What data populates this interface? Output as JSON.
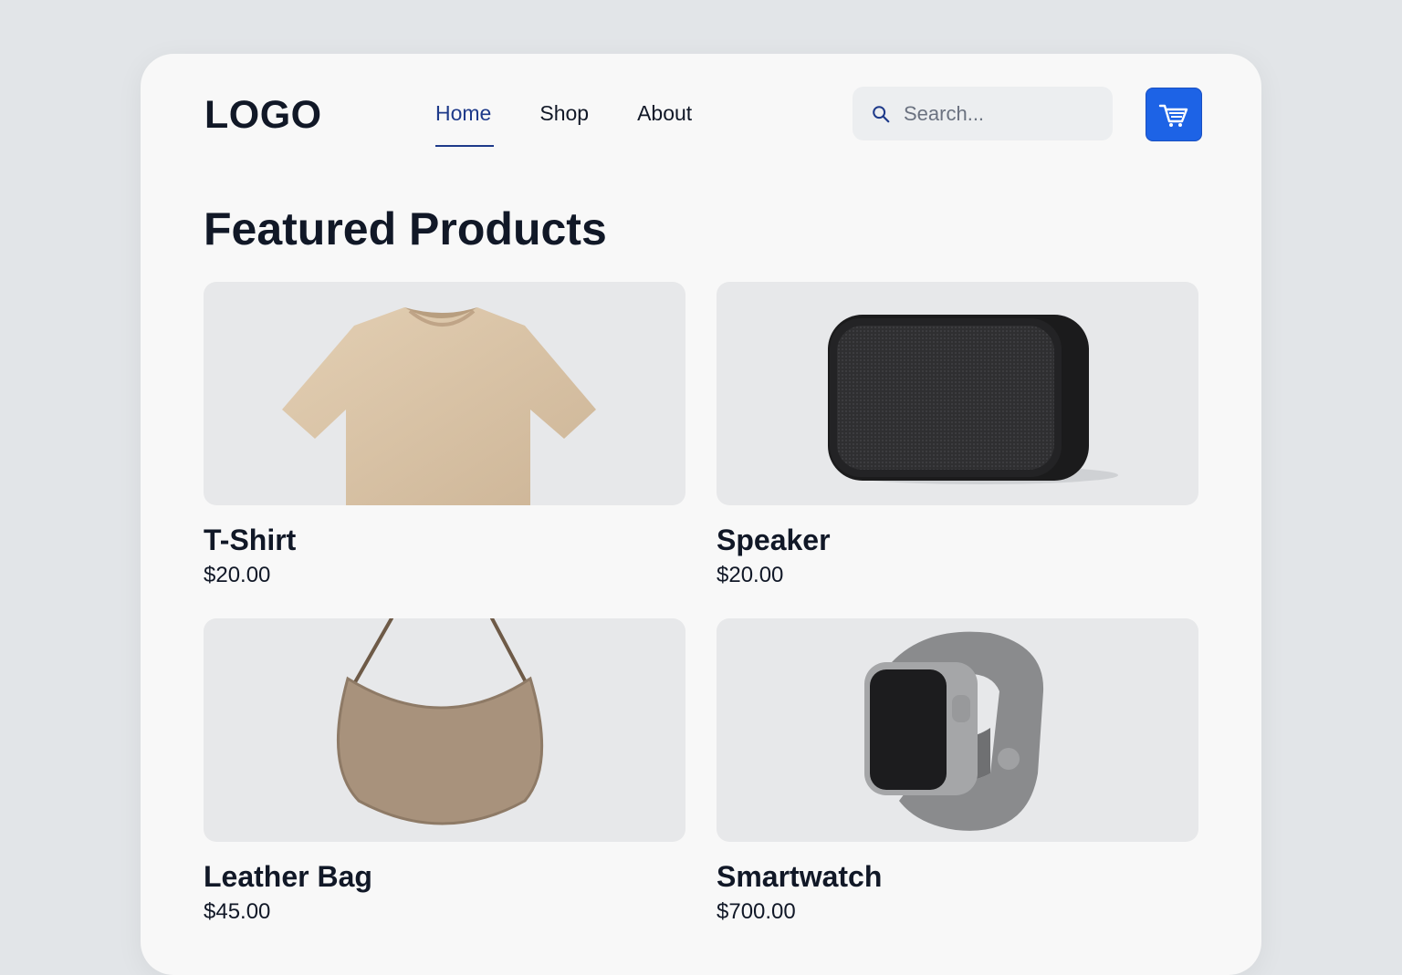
{
  "header": {
    "logo": "LOGO",
    "nav": [
      {
        "label": "Home",
        "active": true
      },
      {
        "label": "Shop",
        "active": false
      },
      {
        "label": "About",
        "active": false
      }
    ],
    "search": {
      "placeholder": "Search...",
      "value": ""
    },
    "cart_icon": "shopping-cart-icon"
  },
  "main": {
    "heading": "Featured Products",
    "products": [
      {
        "name": "T-Shirt",
        "price": "$20.00",
        "image": "tshirt-image"
      },
      {
        "name": "Speaker",
        "price": "$20.00",
        "image": "speaker-image"
      },
      {
        "name": "Leather Bag",
        "price": "$45.00",
        "image": "leather-bag-image"
      },
      {
        "name": "Smartwatch",
        "price": "$700.00",
        "image": "smartwatch-image"
      }
    ]
  },
  "colors": {
    "accent": "#1d63e6",
    "active_nav": "#1e3a8a",
    "text": "#111827",
    "background": "#e2e5e8",
    "card": "#f8f8f8"
  }
}
